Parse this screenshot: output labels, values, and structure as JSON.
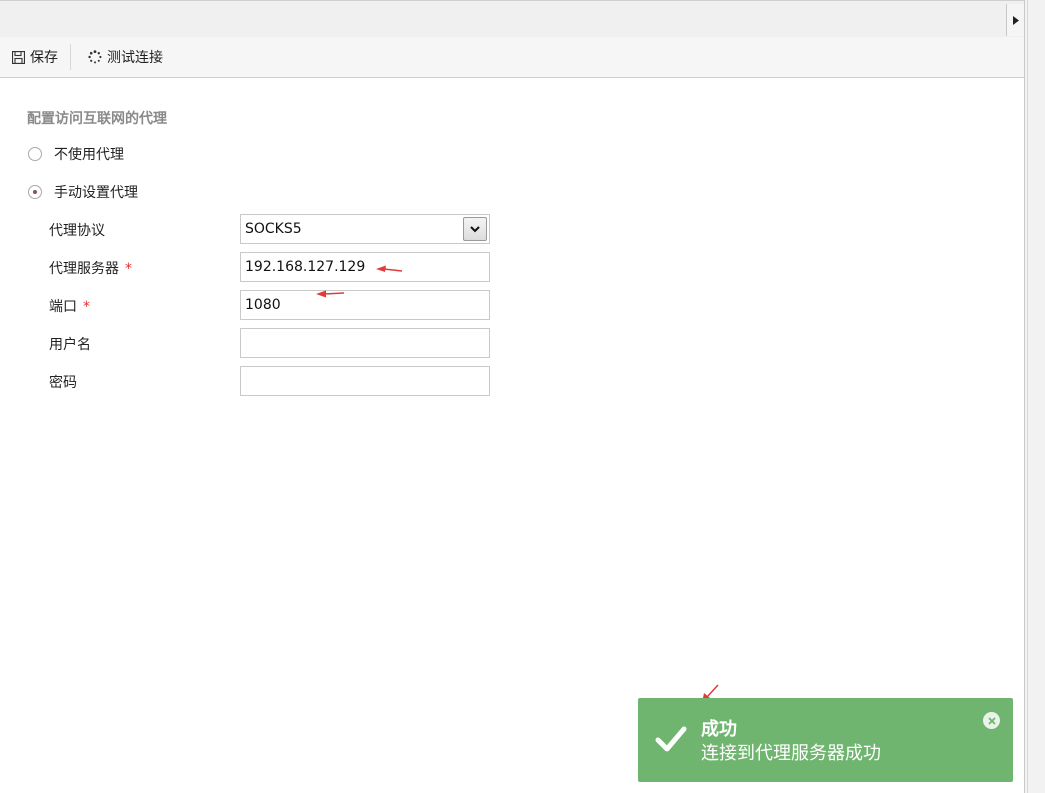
{
  "toolbar": {
    "save_label": "保存",
    "test_label": "测试连接"
  },
  "proxy": {
    "section_title": "配置访问互联网的代理",
    "option_none": "不使用代理",
    "option_manual": "手动设置代理",
    "selected_option": "手动设置代理",
    "fields": {
      "protocol_label": "代理协议",
      "protocol_value": "SOCKS5",
      "server_label": "代理服务器",
      "server_value": "192.168.127.129",
      "port_label": "端口",
      "port_value": "1080",
      "username_label": "用户名",
      "username_value": "",
      "password_label": "密码",
      "password_value": "",
      "required_mark": "*"
    }
  },
  "toast": {
    "title": "成功",
    "message": "连接到代理服务器成功",
    "color": "#6fb56f"
  },
  "icons": [
    "save-icon",
    "spinner-icon",
    "chevron-down-icon",
    "checkmark-icon",
    "close-icon",
    "expand-right-icon",
    "red-arrow-annotation"
  ]
}
